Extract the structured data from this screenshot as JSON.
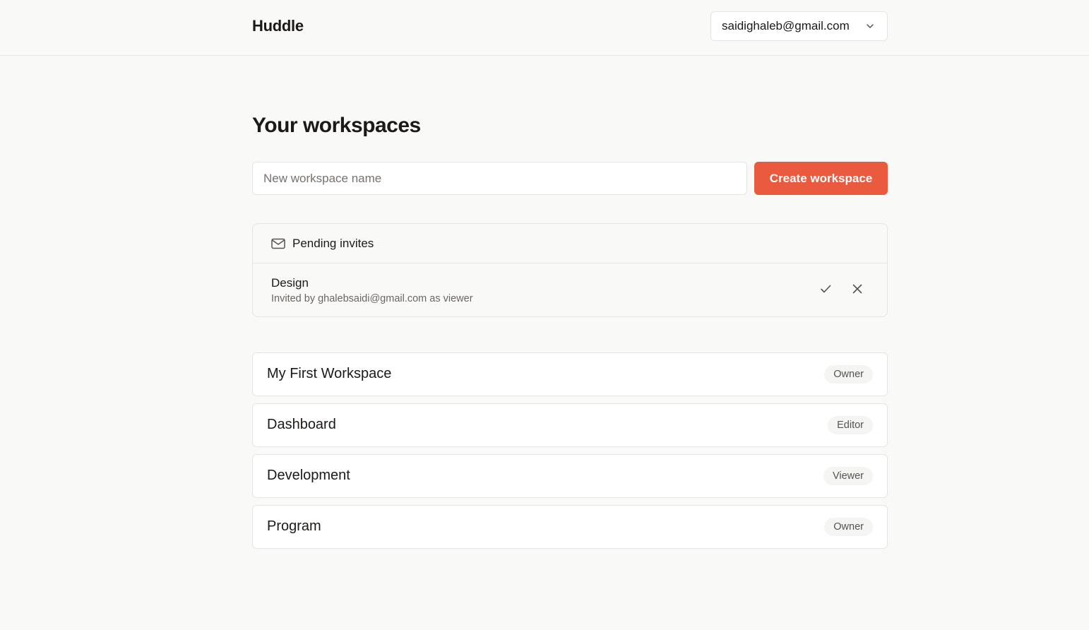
{
  "app": {
    "brand": "Huddle"
  },
  "header": {
    "account_email": "saidighaleb@gmail.com",
    "account_icon": "chevron-down-icon"
  },
  "page": {
    "title": "Your workspaces"
  },
  "create": {
    "input_value": "",
    "input_placeholder": "New workspace name",
    "button_label": "Create workspace",
    "button_color": "#ea5a3f"
  },
  "invites": {
    "heading": "Pending invites",
    "heading_icon": "mail-icon",
    "items": [
      {
        "workspace": "Design",
        "meta": "Invited by ghalebsaidi@gmail.com as viewer",
        "accept_icon": "check-icon",
        "decline_icon": "close-icon"
      }
    ]
  },
  "workspaces": [
    {
      "name": "My First Workspace",
      "role": "Owner"
    },
    {
      "name": "Dashboard",
      "role": "Editor"
    },
    {
      "name": "Development",
      "role": "Viewer"
    },
    {
      "name": "Program",
      "role": "Owner"
    }
  ],
  "colors": {
    "accent": "#ea5a3f",
    "background": "#f9f9f8",
    "border": "#e7e5e4",
    "badge_bg": "#f5f5f4"
  }
}
